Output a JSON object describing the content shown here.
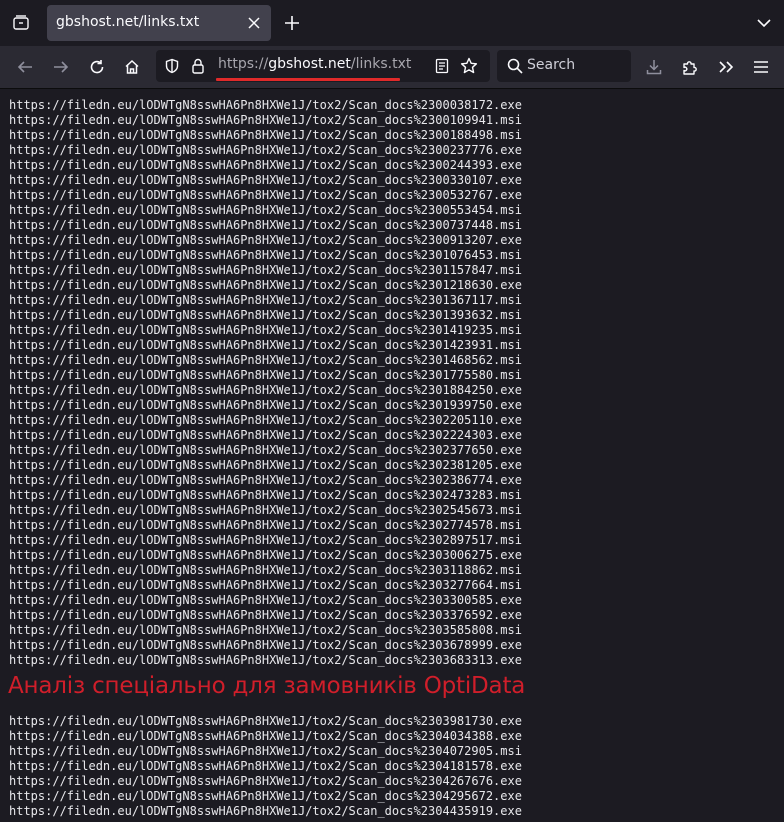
{
  "tab": {
    "title": "gbshost.net/links.txt"
  },
  "urlbar": {
    "scheme": "https://",
    "host": "gbshost.net",
    "path": "/links.txt"
  },
  "search": {
    "placeholder": "Search"
  },
  "accent_colors": {
    "url_underline": "#e02a2a",
    "overlay_text": "#d01e2a"
  },
  "icons": {
    "tab_list": "tab-list-icon",
    "close": "close-icon",
    "new_tab": "plus-icon",
    "overflow": "chevron-down-icon",
    "back": "back-arrow-icon",
    "forward": "forward-arrow-icon",
    "reload": "reload-icon",
    "home": "home-icon",
    "tracking": "shield-icon",
    "lock": "lock-icon",
    "reader": "reader-view-icon",
    "bookmark": "star-icon",
    "search": "search-icon",
    "downloads": "download-icon",
    "extensions": "puzzle-icon",
    "more_tools": "double-chevron-icon",
    "menu": "hamburger-menu-icon"
  },
  "overlay": {
    "text": "Аналіз спеціально для замовників OptiData"
  },
  "links_top": [
    "https://filedn.eu/lODWTgN8sswHA6Pn8HXWe1J/tox2/Scan_docs%2300038172.exe",
    "https://filedn.eu/lODWTgN8sswHA6Pn8HXWe1J/tox2/Scan_docs%2300109941.msi",
    "https://filedn.eu/lODWTgN8sswHA6Pn8HXWe1J/tox2/Scan_docs%2300188498.msi",
    "https://filedn.eu/lODWTgN8sswHA6Pn8HXWe1J/tox2/Scan_docs%2300237776.exe",
    "https://filedn.eu/lODWTgN8sswHA6Pn8HXWe1J/tox2/Scan_docs%2300244393.exe",
    "https://filedn.eu/lODWTgN8sswHA6Pn8HXWe1J/tox2/Scan_docs%2300330107.exe",
    "https://filedn.eu/lODWTgN8sswHA6Pn8HXWe1J/tox2/Scan_docs%2300532767.exe",
    "https://filedn.eu/lODWTgN8sswHA6Pn8HXWe1J/tox2/Scan_docs%2300553454.msi",
    "https://filedn.eu/lODWTgN8sswHA6Pn8HXWe1J/tox2/Scan_docs%2300737448.msi",
    "https://filedn.eu/lODWTgN8sswHA6Pn8HXWe1J/tox2/Scan_docs%2300913207.exe",
    "https://filedn.eu/lODWTgN8sswHA6Pn8HXWe1J/tox2/Scan_docs%2301076453.msi",
    "https://filedn.eu/lODWTgN8sswHA6Pn8HXWe1J/tox2/Scan_docs%2301157847.msi",
    "https://filedn.eu/lODWTgN8sswHA6Pn8HXWe1J/tox2/Scan_docs%2301218630.exe",
    "https://filedn.eu/lODWTgN8sswHA6Pn8HXWe1J/tox2/Scan_docs%2301367117.msi",
    "https://filedn.eu/lODWTgN8sswHA6Pn8HXWe1J/tox2/Scan_docs%2301393632.msi",
    "https://filedn.eu/lODWTgN8sswHA6Pn8HXWe1J/tox2/Scan_docs%2301419235.msi",
    "https://filedn.eu/lODWTgN8sswHA6Pn8HXWe1J/tox2/Scan_docs%2301423931.msi",
    "https://filedn.eu/lODWTgN8sswHA6Pn8HXWe1J/tox2/Scan_docs%2301468562.msi",
    "https://filedn.eu/lODWTgN8sswHA6Pn8HXWe1J/tox2/Scan_docs%2301775580.msi",
    "https://filedn.eu/lODWTgN8sswHA6Pn8HXWe1J/tox2/Scan_docs%2301884250.exe",
    "https://filedn.eu/lODWTgN8sswHA6Pn8HXWe1J/tox2/Scan_docs%2301939750.exe",
    "https://filedn.eu/lODWTgN8sswHA6Pn8HXWe1J/tox2/Scan_docs%2302205110.exe",
    "https://filedn.eu/lODWTgN8sswHA6Pn8HXWe1J/tox2/Scan_docs%2302224303.exe",
    "https://filedn.eu/lODWTgN8sswHA6Pn8HXWe1J/tox2/Scan_docs%2302377650.exe",
    "https://filedn.eu/lODWTgN8sswHA6Pn8HXWe1J/tox2/Scan_docs%2302381205.exe",
    "https://filedn.eu/lODWTgN8sswHA6Pn8HXWe1J/tox2/Scan_docs%2302386774.exe",
    "https://filedn.eu/lODWTgN8sswHA6Pn8HXWe1J/tox2/Scan_docs%2302473283.msi",
    "https://filedn.eu/lODWTgN8sswHA6Pn8HXWe1J/tox2/Scan_docs%2302545673.msi",
    "https://filedn.eu/lODWTgN8sswHA6Pn8HXWe1J/tox2/Scan_docs%2302774578.msi",
    "https://filedn.eu/lODWTgN8sswHA6Pn8HXWe1J/tox2/Scan_docs%2302897517.msi",
    "https://filedn.eu/lODWTgN8sswHA6Pn8HXWe1J/tox2/Scan_docs%2303006275.exe",
    "https://filedn.eu/lODWTgN8sswHA6Pn8HXWe1J/tox2/Scan_docs%2303118862.msi",
    "https://filedn.eu/lODWTgN8sswHA6Pn8HXWe1J/tox2/Scan_docs%2303277664.msi",
    "https://filedn.eu/lODWTgN8sswHA6Pn8HXWe1J/tox2/Scan_docs%2303300585.exe",
    "https://filedn.eu/lODWTgN8sswHA6Pn8HXWe1J/tox2/Scan_docs%2303376592.exe",
    "https://filedn.eu/lODWTgN8sswHA6Pn8HXWe1J/tox2/Scan_docs%2303585808.msi",
    "https://filedn.eu/lODWTgN8sswHA6Pn8HXWe1J/tox2/Scan_docs%2303678999.exe",
    "https://filedn.eu/lODWTgN8sswHA6Pn8HXWe1J/tox2/Scan_docs%2303683313.exe"
  ],
  "links_bottom": [
    "https://filedn.eu/lODWTgN8sswHA6Pn8HXWe1J/tox2/Scan_docs%2303981730.exe",
    "https://filedn.eu/lODWTgN8sswHA6Pn8HXWe1J/tox2/Scan_docs%2304034388.exe",
    "https://filedn.eu/lODWTgN8sswHA6Pn8HXWe1J/tox2/Scan_docs%2304072905.msi",
    "https://filedn.eu/lODWTgN8sswHA6Pn8HXWe1J/tox2/Scan_docs%2304181578.exe",
    "https://filedn.eu/lODWTgN8sswHA6Pn8HXWe1J/tox2/Scan_docs%2304267676.exe",
    "https://filedn.eu/lODWTgN8sswHA6Pn8HXWe1J/tox2/Scan_docs%2304295672.exe",
    "https://filedn.eu/lODWTgN8sswHA6Pn8HXWe1J/tox2/Scan_docs%2304435919.exe"
  ]
}
